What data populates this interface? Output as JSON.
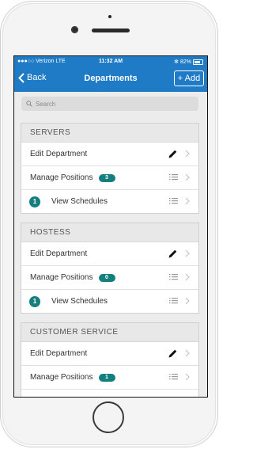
{
  "status_bar": {
    "carrier": "●●●○○ Verizon  LTE",
    "time": "11:32 AM",
    "battery": "✻ 82%"
  },
  "nav": {
    "back_label": "Back",
    "title": "Departments",
    "add_label": "+ Add"
  },
  "search": {
    "placeholder": "Search"
  },
  "sections": [
    {
      "name": "SERVERS",
      "rows": [
        {
          "label": "Edit Department"
        },
        {
          "label": "Manage Positions",
          "badge": "3"
        },
        {
          "label": "View Schedules",
          "count": "1"
        }
      ]
    },
    {
      "name": "HOSTESS",
      "rows": [
        {
          "label": "Edit Department"
        },
        {
          "label": "Manage Positions",
          "badge": "0"
        },
        {
          "label": "View Schedules",
          "count": "1"
        }
      ]
    },
    {
      "name": "CUSTOMER SERVICE",
      "rows": [
        {
          "label": "Edit Department"
        },
        {
          "label": "Manage Positions",
          "badge": "1"
        }
      ]
    }
  ],
  "colors": {
    "nav_bar": "#1f7bc5",
    "badge": "#157f7f"
  }
}
